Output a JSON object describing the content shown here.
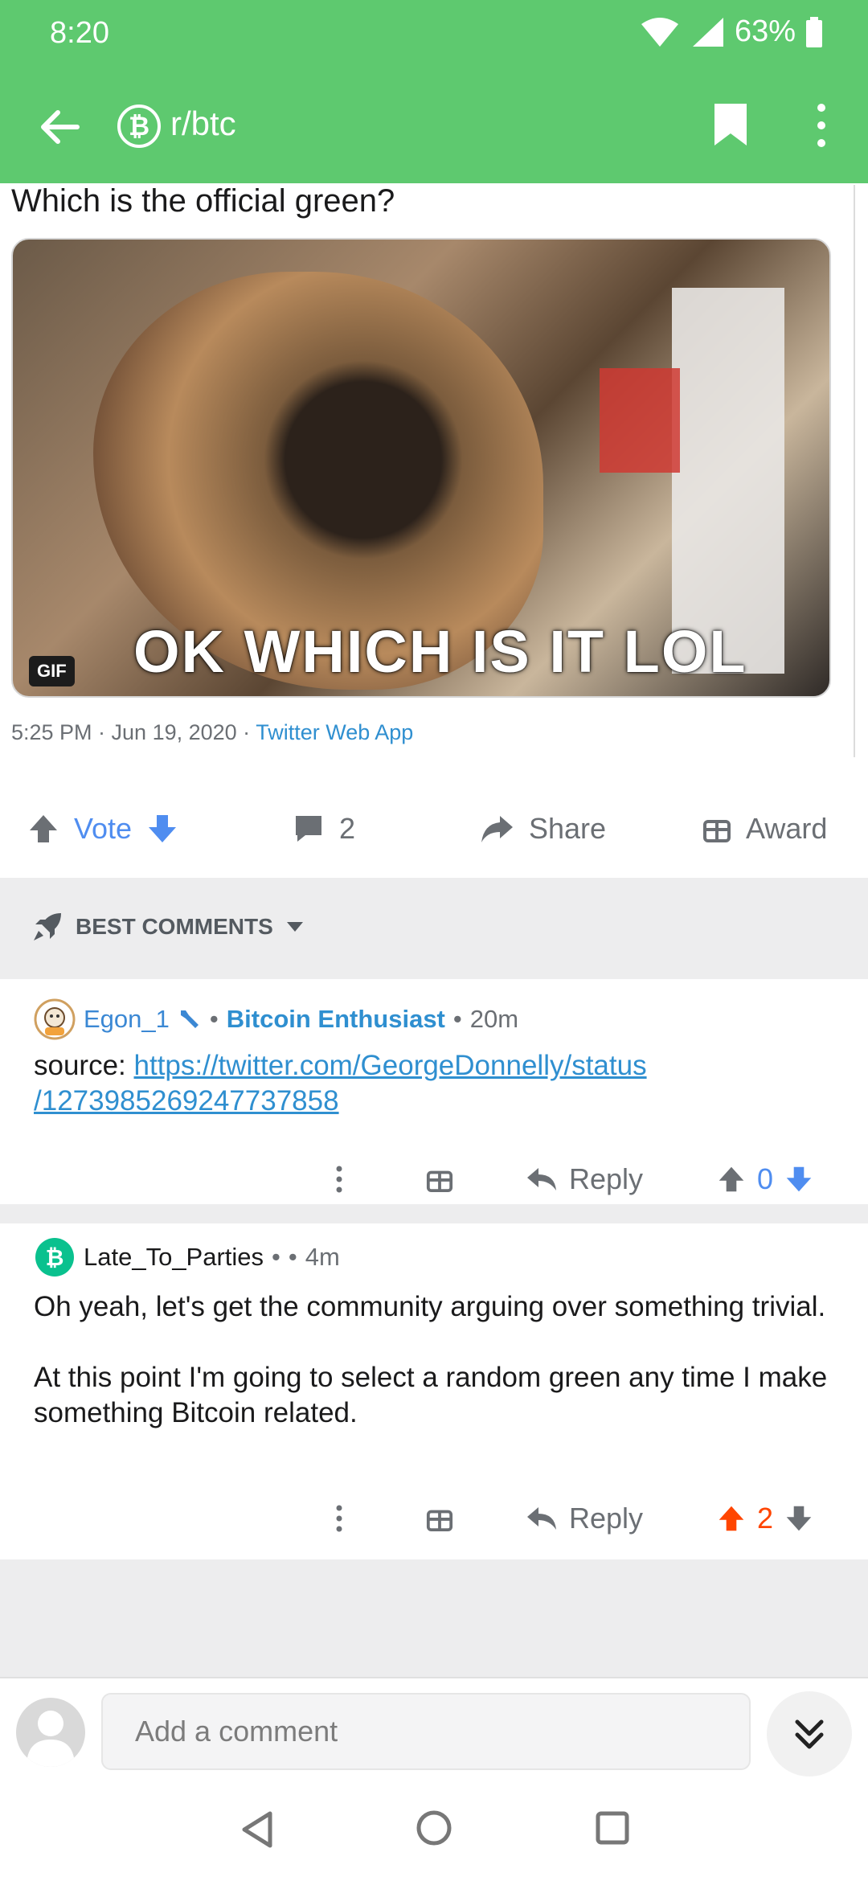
{
  "status_bar": {
    "time": "8:20",
    "battery": "63%"
  },
  "app_bar": {
    "subreddit": "r/btc",
    "sub_icon": "₿"
  },
  "post": {
    "title": "Which is the official green?",
    "media": {
      "caption": "OK WHICH IS IT LOL",
      "badge": "GIF"
    },
    "meta": {
      "time": "5:25 PM · Jun 19, 2020 · ",
      "source": "Twitter Web App"
    }
  },
  "actions": {
    "vote": "Vote",
    "comments": "2",
    "share": "Share",
    "award": "Award"
  },
  "comments_header": {
    "sort_label": "BEST COMMENTS"
  },
  "comments": [
    {
      "user": "Egon_1",
      "flair": "Bitcoin Enthusiast",
      "age": "20m",
      "body_prefix": "source: ",
      "link_line1": "https://twitter.com/GeorgeDonnelly/status",
      "link_line2": "/1273985269247737858",
      "reply": "Reply",
      "score": "0"
    },
    {
      "user": "Late_To_Parties",
      "age": "4m",
      "avatar_glyph": "₿",
      "para1": "Oh yeah, let's get the community arguing over something trivial.",
      "para2": "At this point I'm going to select a random green any time I make something Bitcoin related.",
      "reply": "Reply",
      "score": "2"
    }
  ],
  "composer": {
    "placeholder": "Add a comment"
  },
  "colors": {
    "header": "#5ec96f",
    "link": "#2f8fd0",
    "upvote": "#ff4500",
    "vote_blue": "#4f8df0"
  }
}
